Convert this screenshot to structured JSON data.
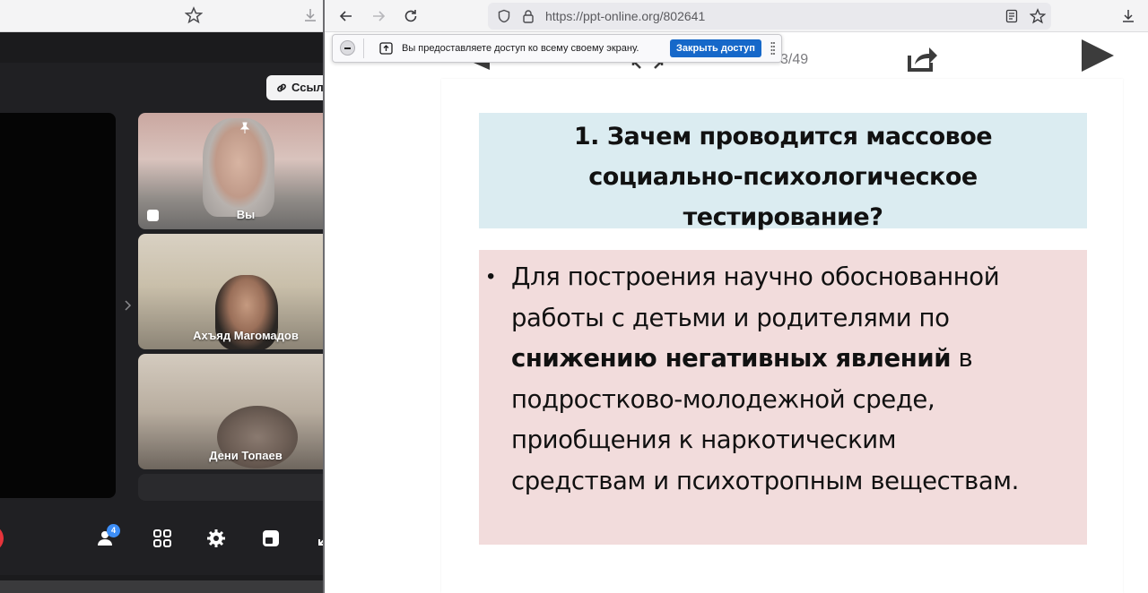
{
  "left_window": {
    "link_button": "Ссыл",
    "participants": [
      {
        "name": "Вы"
      },
      {
        "name": "Ахъяд Магомадов"
      },
      {
        "name": "Дени Топаев"
      }
    ],
    "participants_count": "4",
    "icons": [
      "people-icon",
      "grid-icon",
      "gear-icon",
      "layout-icon"
    ]
  },
  "browser": {
    "url": "https://ppt-online.org/802641"
  },
  "share_bar": {
    "message": "Вы предоставляете доступ ко всему своему экрану.",
    "stop_button": "Закрыть доступ"
  },
  "slideshow": {
    "page_counter": "3/49"
  },
  "slide": {
    "title_lines": [
      "1. Зачем проводится массовое",
      "социально-психологическое",
      "тестирование?"
    ],
    "body_line1": "Для построения научно обоснованной",
    "body_line2": "работы с детьми и родителями по",
    "body_bold": "снижению негативных явлений",
    "body_after_bold": " в",
    "body_line4": "подростково-молодежной среде,",
    "body_line5": "приобщения к наркотическим",
    "body_line6": "средствам и психотропным веществам."
  },
  "colors": {
    "title_box": "#dbecf1",
    "body_box": "#f2dcdc",
    "share_button": "#1668c9",
    "badge": "#3d8ef7"
  }
}
